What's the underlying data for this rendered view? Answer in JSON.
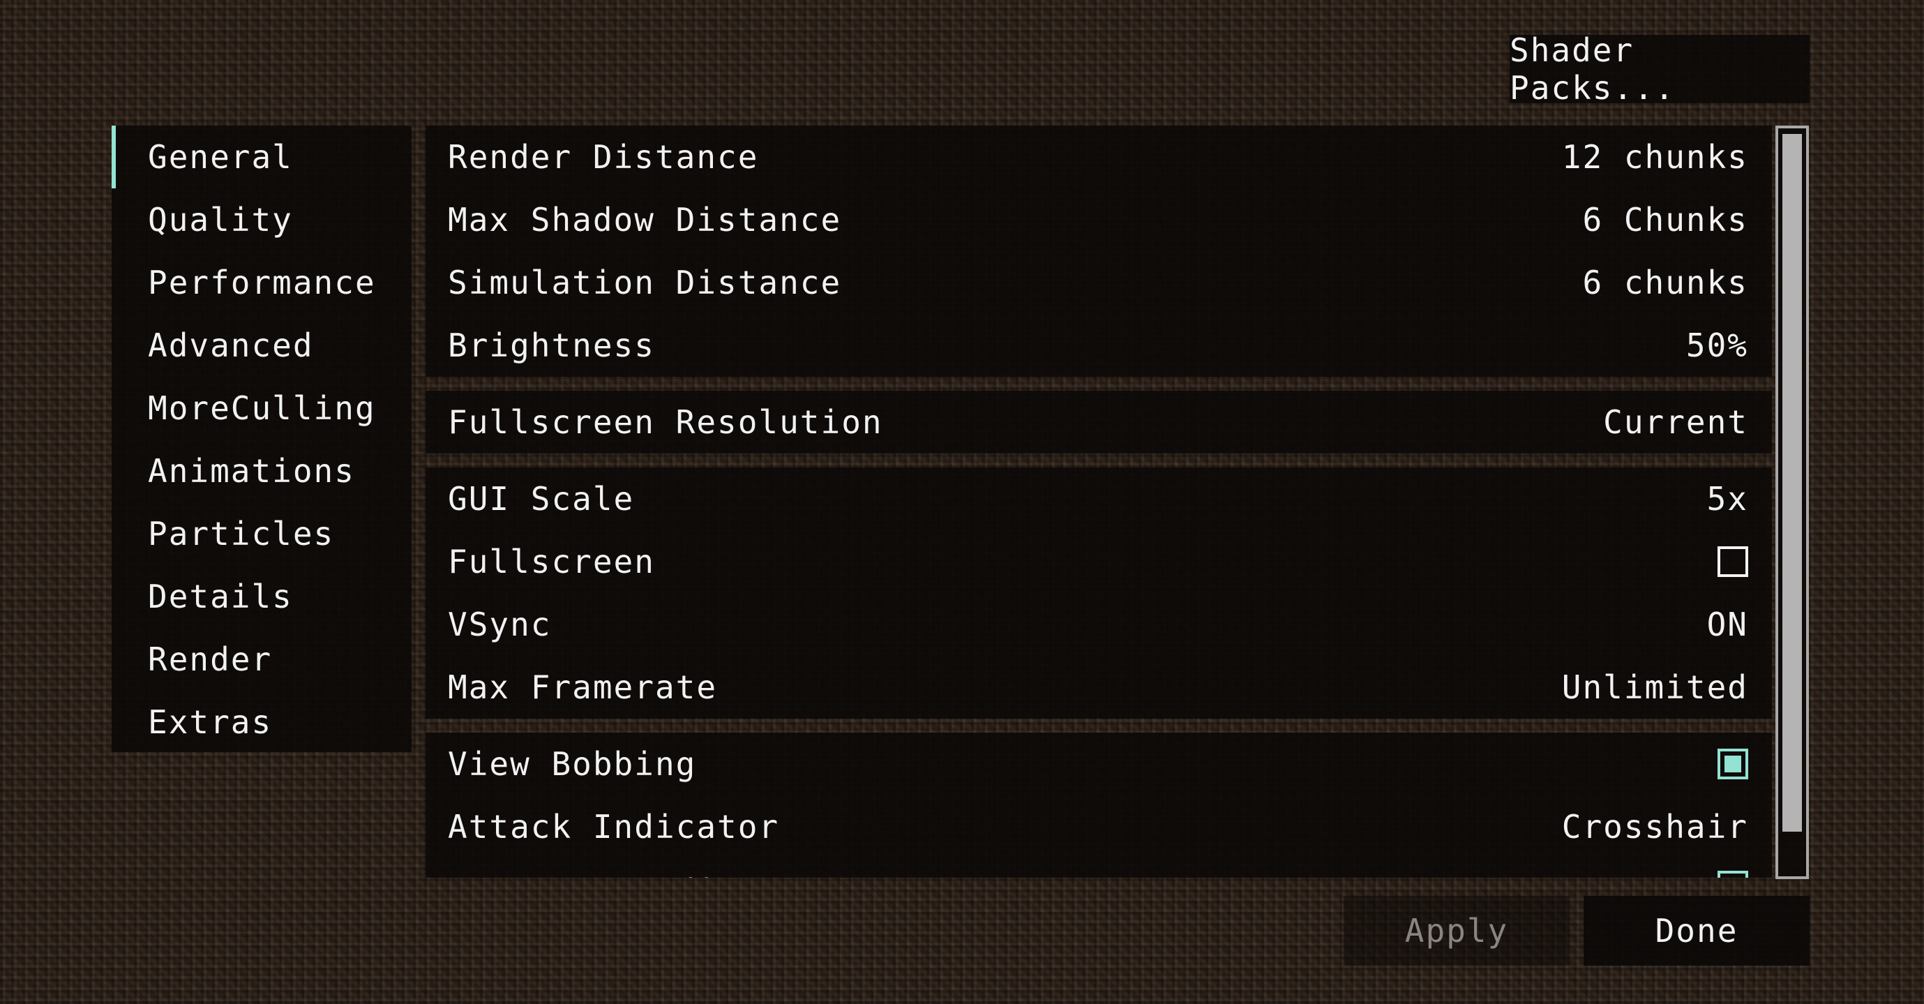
{
  "header": {
    "shader_packs_label": "Shader Packs..."
  },
  "sidebar": {
    "items": [
      {
        "label": "General",
        "active": true
      },
      {
        "label": "Quality"
      },
      {
        "label": "Performance"
      },
      {
        "label": "Advanced"
      },
      {
        "label": "MoreCulling"
      },
      {
        "label": "Animations"
      },
      {
        "label": "Particles"
      },
      {
        "label": "Details"
      },
      {
        "label": "Render"
      },
      {
        "label": "Extras"
      }
    ]
  },
  "options": {
    "group1": [
      {
        "label": "Render Distance",
        "value": "12 chunks"
      },
      {
        "label": "Max Shadow Distance",
        "value": "6 Chunks"
      },
      {
        "label": "Simulation Distance",
        "value": "6 chunks"
      },
      {
        "label": "Brightness",
        "value": "50%"
      }
    ],
    "group2": [
      {
        "label": "Fullscreen Resolution",
        "value": "Current"
      }
    ],
    "group3": [
      {
        "label": "GUI Scale",
        "value": "5x"
      },
      {
        "label": "Fullscreen",
        "checked": false
      },
      {
        "label": "VSync",
        "value": "ON"
      },
      {
        "label": "Max Framerate",
        "value": "Unlimited"
      }
    ],
    "group4": [
      {
        "label": "View Bobbing",
        "checked": true
      },
      {
        "label": "Attack Indicator",
        "value": "Crosshair"
      }
    ],
    "clipped_row": {
      "label": "Autosave Indicator"
    }
  },
  "footer": {
    "apply_label": "Apply",
    "done_label": "Done"
  },
  "colors": {
    "accent": "#93e3d2",
    "text": "#f2f2f2",
    "disabled_text": "#8a8582",
    "panel": "#0c0908",
    "scrollbar": "#b4b4b4"
  },
  "scroll": {
    "position_fraction": 0.0,
    "visible_fraction": 0.92
  }
}
